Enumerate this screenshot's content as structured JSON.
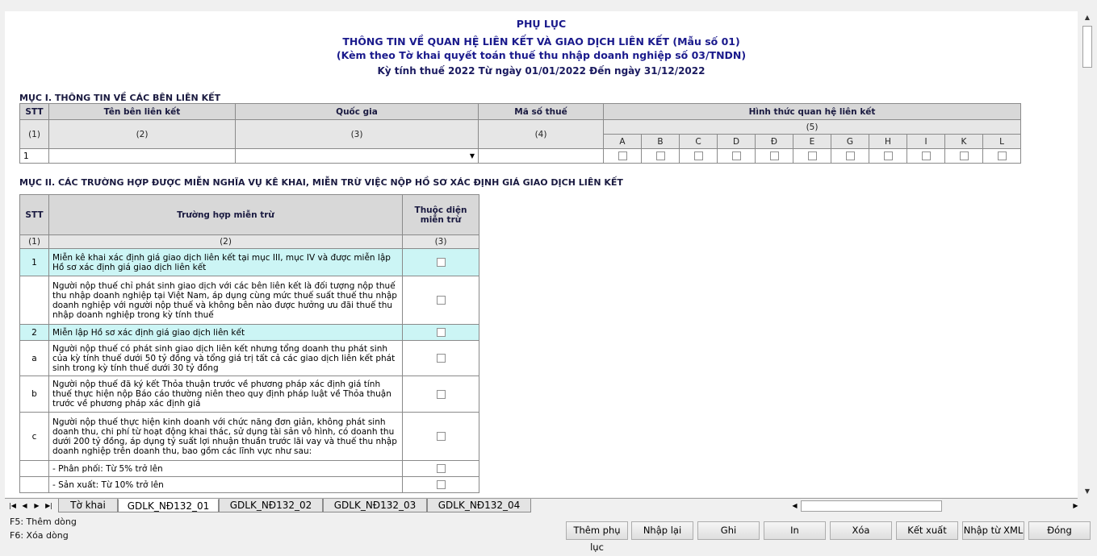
{
  "header": {
    "title1": "PHỤ LỤC",
    "title2": "THÔNG TIN VỀ QUAN HỆ LIÊN KẾT VÀ GIAO DỊCH LIÊN KẾT (Mẫu số 01)",
    "title3": "(Kèm theo Tờ khai quyết toán thuế thu nhập doanh nghiệp số 03/TNDN)",
    "period": "Kỳ tính thuế 2022 Từ ngày 01/01/2022 Đến ngày 31/12/2022"
  },
  "section1": {
    "title": "MỤC I. THÔNG TIN VỀ CÁC BÊN LIÊN KẾT",
    "headers": {
      "stt": "STT",
      "name": "Tên bên liên kết",
      "country": "Quốc gia",
      "taxcode": "Mã số thuế",
      "relation": "Hình thức quan hệ liên kết"
    },
    "numbers": {
      "stt": "(1)",
      "name": "(2)",
      "country": "(3)",
      "taxcode": "(4)",
      "relation": "(5)"
    },
    "letters": [
      "A",
      "B",
      "C",
      "D",
      "Đ",
      "E",
      "G",
      "H",
      "I",
      "K",
      "L"
    ],
    "row": {
      "stt": "1",
      "name": "",
      "country": "",
      "taxcode": ""
    }
  },
  "section2": {
    "title": "MỤC II. CÁC TRƯỜNG HỢP ĐƯỢC MIỄN NGHĨA VỤ KÊ KHAI, MIỄN TRỪ VIỆC NỘP HỒ SƠ XÁC ĐỊNH GIÁ GIAO DỊCH LIÊN KẾT",
    "headers": {
      "stt": "STT",
      "case": "Trường hợp miễn trừ",
      "exempt": "Thuộc diện miễn trừ"
    },
    "numbers": {
      "stt": "(1)",
      "case": "(2)",
      "exempt": "(3)"
    },
    "rows": [
      {
        "stt": "1",
        "text": "Miễn kê khai xác định giá giao dịch liên kết tại mục III, mục IV và được miễn lập Hồ sơ xác định giá giao dịch liên kết"
      },
      {
        "stt": "",
        "text": "Người nộp thuế chỉ phát sinh giao dịch với các bên liên kết là đối tượng nộp thuế thu nhập doanh nghiệp tại Việt Nam, áp dụng cùng mức thuế suất thuế thu nhập doanh nghiệp với người nộp thuế và không bên nào được hưởng ưu đãi thuế thu nhập doanh nghiệp trong kỳ tính thuế"
      },
      {
        "stt": "2",
        "text": "Miễn lập Hồ sơ xác định giá giao dịch liên kết"
      },
      {
        "stt": "a",
        "text": "Người nộp thuế có phát sinh giao dịch liên kết nhưng tổng doanh thu phát sinh của kỳ tính thuế dưới 50 tỷ đồng và tổng giá trị tất cả các giao dịch liên kết phát sinh trong kỳ tính thuế dưới 30 tỷ đồng"
      },
      {
        "stt": "b",
        "text": "Người nộp thuế đã ký kết Thỏa thuận trước về phương pháp xác định giá tính thuế thực hiện nộp Báo cáo thường niên theo quy định pháp luật về Thỏa thuận trước về phương pháp xác định giá"
      },
      {
        "stt": "c",
        "text": "Người nộp thuế thực hiện kinh doanh với chức năng đơn giản, không phát sinh doanh thu, chi phí từ hoạt động khai thác, sử dụng tài sản vô hình, có doanh thu dưới 200 tỷ đồng, áp dụng tỷ suất lợi nhuận thuần trước lãi vay và thuế thu nhập doanh nghiệp trên doanh thu, bao gồm các lĩnh vực như sau:"
      },
      {
        "stt": "",
        "text": "- Phân phối: Từ 5% trở lên"
      },
      {
        "stt": "",
        "text": "- Sản xuất: Từ 10% trở lên"
      }
    ]
  },
  "tabs": [
    "Tờ khai",
    "GDLK_NĐ132_01",
    "GDLK_NĐ132_02",
    "GDLK_NĐ132_03",
    "GDLK_NĐ132_04"
  ],
  "hints": {
    "f5": "F5: Thêm dòng",
    "f6": "F6: Xóa dòng"
  },
  "buttons": {
    "add_appendix": "Thêm phụ lục",
    "reenter": "Nhập lại",
    "save": "Ghi",
    "print": "In",
    "delete": "Xóa",
    "export": "Kết xuất",
    "import_xml": "Nhập từ XML",
    "close": "Đóng"
  }
}
